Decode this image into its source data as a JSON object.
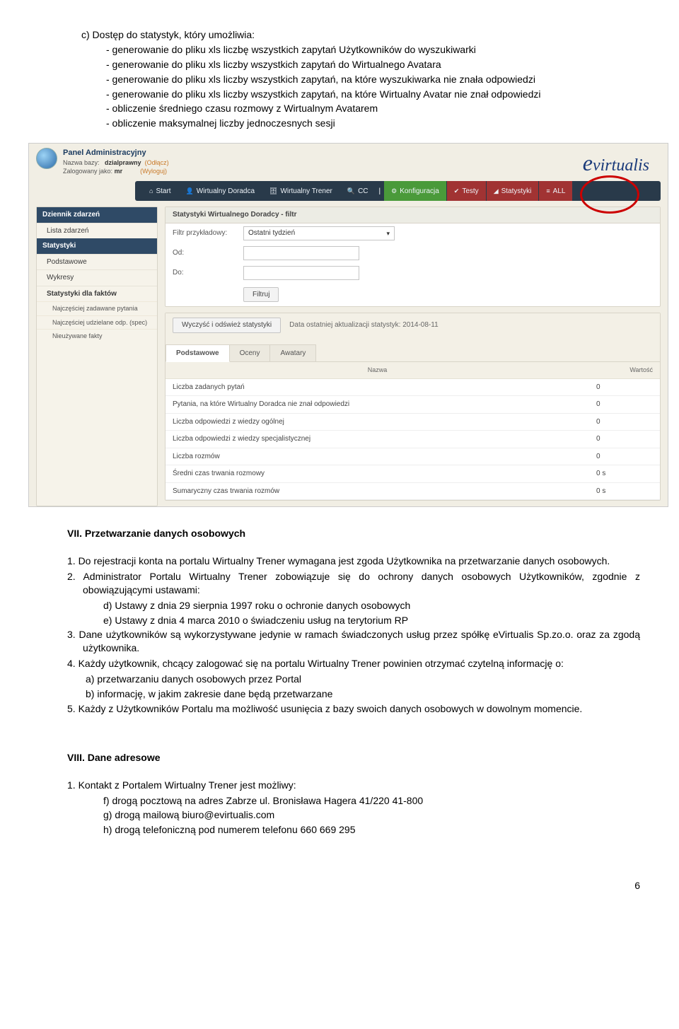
{
  "doc": {
    "c_line": "c)  Dostęp do statystyk, który umożliwia:",
    "dashes": [
      "- generowanie do pliku xls liczbę wszystkich zapytań Użytkowników do wyszukiwarki",
      "- generowanie do pliku xls liczby wszystkich zapytań do Wirtualnego Avatara",
      "- generowanie do pliku xls liczby wszystkich zapytań, na które wyszukiwarka nie znała odpowiedzi",
      "- generowanie do pliku xls liczby wszystkich zapytań, na które Wirtualny Avatar nie znał odpowiedzi",
      "- obliczenie średniego czasu rozmowy z Wirtualnym Avatarem",
      "- obliczenie maksymalnej liczby jednoczesnych sesji"
    ],
    "section7": "VII. Przetwarzanie danych osobowych",
    "s7_items": [
      "1.  Do rejestracji konta na portalu Wirtualny Trener wymagana jest zgoda Użytkownika na przetwarzanie danych osobowych.",
      "2.  Administrator Portalu Wirtualny Trener zobowiązuje się do ochrony danych osobowych Użytkowników, zgodnie z obowiązującymi ustawami:"
    ],
    "s7_sub2": [
      "d)  Ustawy z dnia 29 sierpnia 1997 roku o ochronie danych osobowych",
      "e)  Ustawy z dnia 4 marca 2010 o świadczeniu usług na terytorium RP"
    ],
    "s7_item3": "3.  Dane użytkowników są wykorzystywane jedynie w ramach świadczonych usług przez spółkę eVirtualis Sp.zo.o. oraz za zgodą użytkownika.",
    "s7_item4": "4.  Każdy użytkownik, chcący zalogować się na portalu Wirtualny Trener powinien otrzymać czytelną informację o:",
    "s7_sub4": [
      "a)  przetwarzaniu danych osobowych przez Portal",
      "b)  informację, w jakim zakresie dane będą przetwarzane"
    ],
    "s7_item5": "5.  Każdy z Użytkowników Portalu ma możliwość usunięcia z bazy swoich danych osobowych w dowolnym momencie.",
    "section8": "VIII. Dane adresowe",
    "s8_item1": "1.  Kontakt z Portalem Wirtualny Trener jest możliwy:",
    "s8_sub1": [
      "f)   drogą pocztową na adres Zabrze ul. Bronisława Hagera 41/220 41-800",
      "g)  drogą mailową biuro@evirtualis.com",
      "h)  drogą telefoniczną pod numerem telefonu 660 669 295"
    ],
    "page_num": "6"
  },
  "ss": {
    "panel_title": "Panel Administracyjny",
    "meta_line1_label": "Nazwa bazy:",
    "meta_line1_value": "dzialprawny",
    "meta_line1_action": "(Odłącz)",
    "meta_line2_label": "Zalogowany jako:",
    "meta_line2_value": "mr",
    "meta_line2_action": "(Wyloguj)",
    "logo_text": "virtualis",
    "nav": {
      "start": "Start",
      "doradca": "Wirtualny Doradca",
      "trener": "Wirtualny Trener",
      "cc": "CC",
      "konf": "Konfiguracja",
      "testy": "Testy",
      "stat": "Statystyki",
      "all": "ALL"
    },
    "sidebar": {
      "h1": "Dziennik zdarzeń",
      "i1": "Lista zdarzeń",
      "h2": "Statystyki",
      "i2a": "Podstawowe",
      "i2b": "Wykresy",
      "i2c": "Statystyki dla faktów",
      "s1": "Najczęściej zadawane pytania",
      "s2": "Najczęściej udzielane odp. (spec)",
      "s3": "Nieużywane fakty"
    },
    "main": {
      "box1_head": "Statystyki Wirtualnego Doradcy - filtr",
      "f1_label": "Filtr przykładowy:",
      "f1_value": "Ostatni tydzień",
      "f2_label": "Od:",
      "f3_label": "Do:",
      "btn_filter": "Filtruj",
      "btn_clear": "Wyczyść i odśwież statystyki",
      "status": "Data ostatniej aktualizacji statystyk: 2014-08-11",
      "tabs": {
        "t1": "Podstawowe",
        "t2": "Oceny",
        "t3": "Awatary"
      },
      "th_name": "Nazwa",
      "th_val": "Wartość",
      "rows": [
        {
          "n": "Liczba zadanych pytań",
          "v": "0"
        },
        {
          "n": "Pytania, na które Wirtualny Doradca nie znał odpowiedzi",
          "v": "0"
        },
        {
          "n": "Liczba odpowiedzi z wiedzy ogólnej",
          "v": "0"
        },
        {
          "n": "Liczba odpowiedzi z wiedzy specjalistycznej",
          "v": "0"
        },
        {
          "n": "Liczba rozmów",
          "v": "0"
        },
        {
          "n": "Średni czas trwania rozmowy",
          "v": "0 s"
        },
        {
          "n": "Sumaryczny czas trwania rozmów",
          "v": "0 s"
        }
      ]
    }
  }
}
